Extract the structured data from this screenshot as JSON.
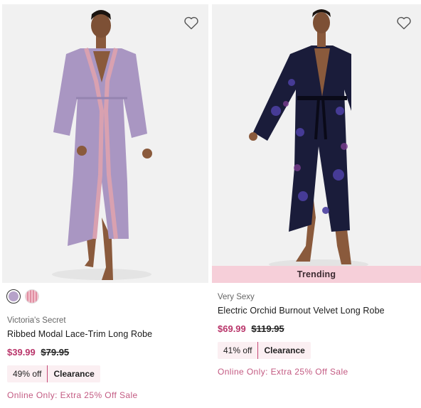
{
  "products": [
    {
      "brand": "Victoria's Secret",
      "name": "Ribbed Modal Lace-Trim Long Robe",
      "sale_price": "$39.99",
      "original_price": "$79.95",
      "discount": "49% off",
      "tag": "Clearance",
      "promo": "Online Only: Extra 25% Off Sale",
      "swatches": [
        {
          "color": "#b6a2c9",
          "selected": true
        },
        {
          "color": "#e8a9b7",
          "selected": false
        }
      ],
      "robe_color": "#a996c2"
    },
    {
      "badge": "Trending",
      "brand": "Very Sexy",
      "name": "Electric Orchid Burnout Velvet Long Robe",
      "sale_price": "$69.99",
      "original_price": "$119.95",
      "discount": "41% off",
      "tag": "Clearance",
      "promo": "Online Only: Extra 25% Off Sale",
      "robe_color": "#1a1c3a"
    }
  ],
  "icons": {
    "wishlist": "heart-outline-icon"
  }
}
